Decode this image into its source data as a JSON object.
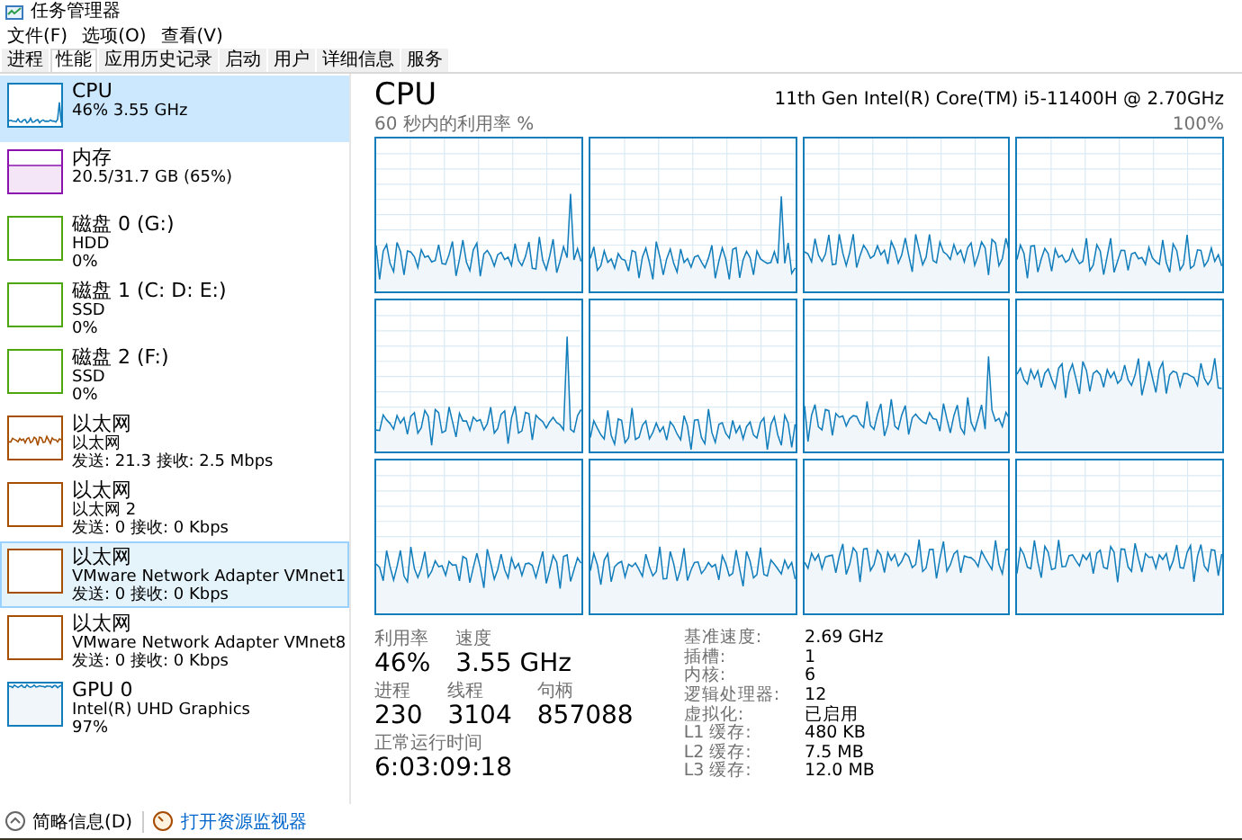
{
  "window": {
    "title": "任务管理器"
  },
  "menu": [
    "文件(F)",
    "选项(O)",
    "查看(V)"
  ],
  "tabs": [
    {
      "label": "进程",
      "selected": false
    },
    {
      "label": "性能",
      "selected": true
    },
    {
      "label": "应用历史记录",
      "selected": false
    },
    {
      "label": "启动",
      "selected": false
    },
    {
      "label": "用户",
      "selected": false
    },
    {
      "label": "详细信息",
      "selected": false
    },
    {
      "label": "服务",
      "selected": false
    }
  ],
  "sidebar": {
    "items": [
      {
        "kind": "cpu",
        "color": "#117dbb",
        "title": "CPU",
        "lines": [
          "46% 3.55 GHz"
        ],
        "selected": true,
        "hovered": false
      },
      {
        "kind": "memory",
        "color": "#8b12ae",
        "title": "内存",
        "lines": [
          "20.5/31.7 GB (65%)"
        ],
        "selected": false,
        "hovered": false
      },
      {
        "kind": "disk",
        "color": "#4da60c",
        "title": "磁盘 0 (G:)",
        "lines": [
          "HDD",
          "0%"
        ],
        "selected": false,
        "hovered": false
      },
      {
        "kind": "disk",
        "color": "#4da60c",
        "title": "磁盘 1 (C: D: E:)",
        "lines": [
          "SSD",
          "0%"
        ],
        "selected": false,
        "hovered": false
      },
      {
        "kind": "disk",
        "color": "#4da60c",
        "title": "磁盘 2 (F:)",
        "lines": [
          "SSD",
          "0%"
        ],
        "selected": false,
        "hovered": false
      },
      {
        "kind": "network_active",
        "color": "#a74f01",
        "title": "以太网",
        "lines": [
          "以太网",
          "发送: 21.3 接收: 2.5 Mbps"
        ],
        "selected": false,
        "hovered": false
      },
      {
        "kind": "network",
        "color": "#a74f01",
        "title": "以太网",
        "lines": [
          "以太网 2",
          "发送: 0 接收: 0 Kbps"
        ],
        "selected": false,
        "hovered": false
      },
      {
        "kind": "network",
        "color": "#a74f01",
        "title": "以太网",
        "lines": [
          "VMware Network Adapter VMnet1",
          "发送: 0 接收: 0 Kbps"
        ],
        "selected": false,
        "hovered": true
      },
      {
        "kind": "network",
        "color": "#a74f01",
        "title": "以太网",
        "lines": [
          "VMware Network Adapter VMnet8",
          "发送: 0 接收: 0 Kbps"
        ],
        "selected": false,
        "hovered": false
      },
      {
        "kind": "gpu",
        "color": "#117dbb",
        "title": "GPU 0",
        "lines": [
          "Intel(R) UHD Graphics",
          "97%"
        ],
        "selected": false,
        "hovered": false
      }
    ]
  },
  "detail": {
    "title": "CPU",
    "model": "11th Gen Intel(R) Core(TM) i5-11400H @ 2.70GHz",
    "graph_label": "60 秒内的利用率 %",
    "graph_max": "100%",
    "stat_rows": [
      [
        {
          "label": "利用率",
          "value": "46%"
        },
        {
          "label": "速度",
          "value": "3.55 GHz"
        }
      ],
      [
        {
          "label": "进程",
          "value": "230"
        },
        {
          "label": "线程",
          "value": "3104"
        },
        {
          "label": "句柄",
          "value": "857088"
        }
      ],
      [
        {
          "label": "正常运行时间",
          "value": "6:03:09:18"
        }
      ]
    ],
    "specs": [
      {
        "label": "基准速度:",
        "value": "2.69 GHz"
      },
      {
        "label": "插槽:",
        "value": "1"
      },
      {
        "label": "内核:",
        "value": "6"
      },
      {
        "label": "逻辑处理器:",
        "value": "12"
      },
      {
        "label": "虚拟化:",
        "value": "已启用"
      },
      {
        "label": "L1 缓存:",
        "value": "480 KB"
      },
      {
        "label": "L2 缓存:",
        "value": "7.5 MB"
      },
      {
        "label": "L3 缓存:",
        "value": "12.0 MB"
      }
    ]
  },
  "footer": {
    "collapse": "简略信息(D)",
    "link": "打开资源监视器"
  }
}
